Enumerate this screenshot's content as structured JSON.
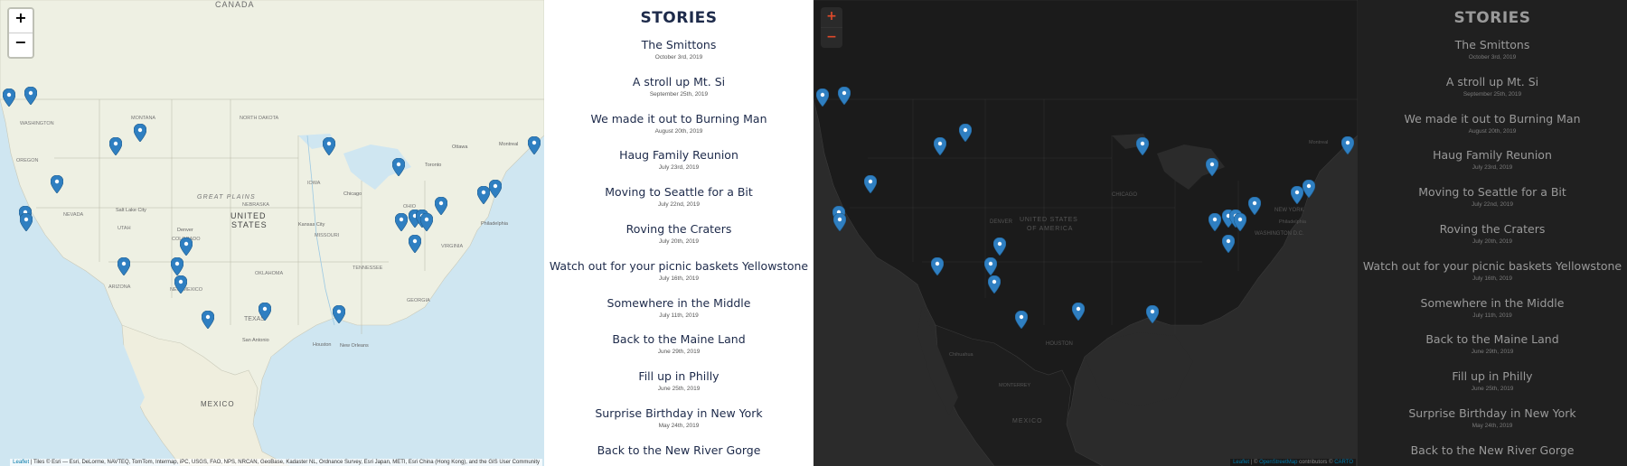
{
  "light_map": {
    "zoom_in": "+",
    "zoom_out": "−",
    "labels": {
      "canada": "CANADA",
      "united_states_1": "UNITED",
      "united_states_2": "STATES",
      "mexico": "MEXICO",
      "great_plains": "GREAT PLAINS",
      "washington": "WASHINGTON",
      "north_dakota": "NORTH DAKOTA",
      "nebraska": "NEBRASKA",
      "kansas_city": "Kansas City",
      "chicago": "Chicago",
      "houston": "Houston",
      "san_antonio": "San Antonio",
      "denver": "Denver",
      "salt_lake_city": "Salt Lake City",
      "philadelphia": "Philadelphia",
      "toronto": "Toronto",
      "ottawa": "Ottawa",
      "montreal": "Montreal",
      "new_orleans": "New Orleans",
      "montana": "MONTANA",
      "oregon": "OREGON",
      "nevada": "NEVADA",
      "utah": "UTAH",
      "colorado": "COLORADO",
      "texas": "TEXAS",
      "oklahoma": "OKLAHOMA",
      "missouri": "MISSOURI",
      "iowa": "IOWA",
      "ohio": "OHIO",
      "tennessee": "TENNESSEE",
      "georgia": "GEORGIA",
      "virginia": "VIRGINIA",
      "arizona": "ARIZONA",
      "new_mexico": "NEW MEXICO"
    },
    "attribution_link": "Leaflet",
    "attribution_text": " | Tiles © Esri — Esri, DeLorme, NAVTEQ, TomTom, Intermap, iPC, USGS, FAO, NPS, NRCAN, GeoBase, Kadaster NL, Ordnance Survey, Esri Japan, METI, Esri China (Hong Kong), and the GIS User Community"
  },
  "dark_map": {
    "zoom_in": "+",
    "zoom_out": "−",
    "labels": {
      "united_states_1": "UNITED STATES",
      "united_states_2": "OF AMERICA",
      "chicago": "CHICAGO",
      "denver": "DENVER",
      "houston": "HOUSTON",
      "new_york": "NEW YORK",
      "washington_dc": "WASHINGTON D.C.",
      "mexico": "MEXICO",
      "monterrey": "MONTERREY",
      "chihuahua": "Chihuahua",
      "philadelphia": "Philadelphia",
      "montreal": "Montreal"
    },
    "attribution_link_1": "Leaflet",
    "attribution_text_1": " | © ",
    "attribution_link_2": "OpenStreetMap",
    "attribution_text_2": " contributors © ",
    "attribution_link_3": "CARTO"
  },
  "sidebar": {
    "title": "STORIES",
    "stories": [
      {
        "title": "The Smittons",
        "date": "October 3rd, 2019"
      },
      {
        "title": "A stroll up Mt. Si",
        "date": "September 25th, 2019"
      },
      {
        "title": "We made it out to Burning Man",
        "date": "August 20th, 2019"
      },
      {
        "title": "Haug Family Reunion",
        "date": "July 23rd, 2019"
      },
      {
        "title": "Moving to Seattle for a Bit",
        "date": "July 22nd, 2019"
      },
      {
        "title": "Roving the Craters",
        "date": "July 20th, 2019"
      },
      {
        "title": "Watch out for your picnic baskets Yellowstone",
        "date": "July 16th, 2019"
      },
      {
        "title": "Somewhere in the Middle",
        "date": "July 11th, 2019"
      },
      {
        "title": "Back to the Maine Land",
        "date": "June 29th, 2019"
      },
      {
        "title": "Fill up in Philly",
        "date": "June 25th, 2019"
      },
      {
        "title": "Surprise Birthday in New York",
        "date": "May 24th, 2019"
      },
      {
        "title": "Back to the New River Gorge",
        "date": ""
      }
    ]
  },
  "colors": {
    "marker": "#2f7fc1",
    "light_land": "#eef0e3",
    "light_water": "#cfe6f1",
    "dark_land": "#1b1b1b",
    "dark_water": "#2b2b2b"
  }
}
